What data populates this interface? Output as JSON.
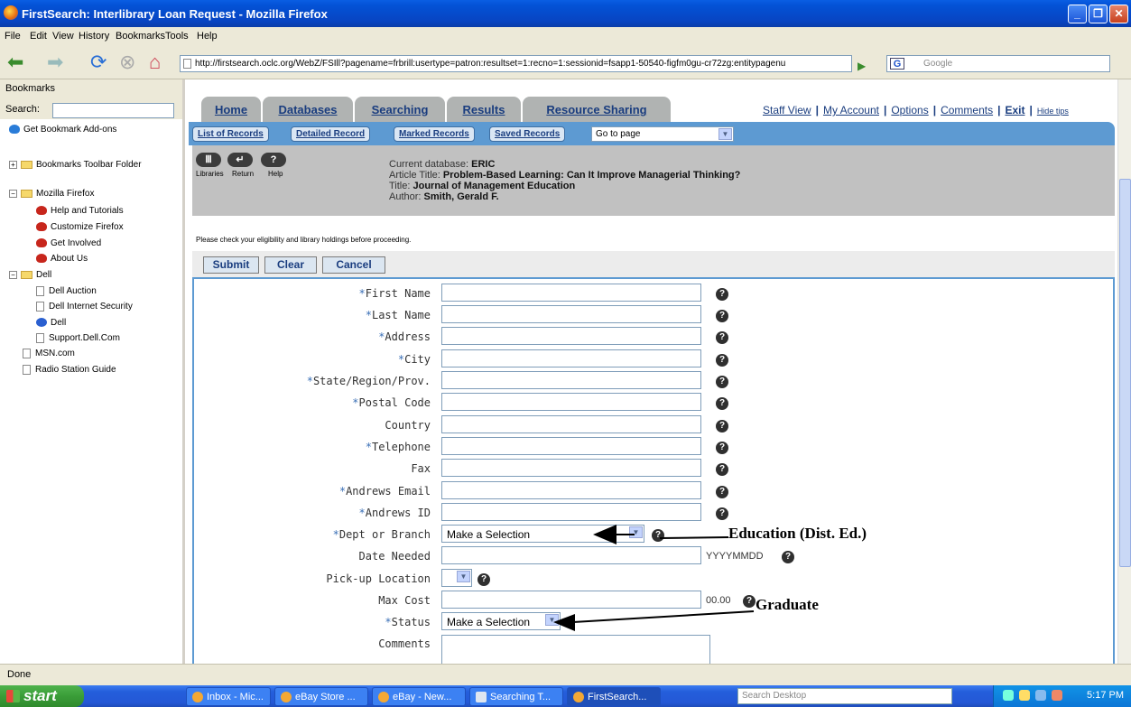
{
  "window": {
    "title": "FirstSearch: Interlibrary Loan Request - Mozilla Firefox"
  },
  "menu": [
    "File",
    "Edit",
    "View",
    "History",
    "Bookmarks",
    "Tools",
    "Help"
  ],
  "nav": {
    "url": "http://firstsearch.oclc.org/WebZ/FSIll?pagename=frbrill:usertype=patron:resultset=1:recno=1:sessionid=fsapp1-50540-figfm0gu-cr72zg:entitypagenu",
    "search_placeholder": "Google"
  },
  "sidebar": {
    "title": "Bookmarks",
    "search_label": "Search:",
    "items": [
      {
        "label": "Get Bookmark Add-ons"
      },
      {
        "label": "Bookmarks Toolbar Folder"
      },
      {
        "label": "Mozilla Firefox"
      },
      {
        "label": "Help and Tutorials"
      },
      {
        "label": "Customize Firefox"
      },
      {
        "label": "Get Involved"
      },
      {
        "label": "About Us"
      },
      {
        "label": "Dell"
      },
      {
        "label": "Dell Auction"
      },
      {
        "label": "Dell Internet Security"
      },
      {
        "label": "Dell"
      },
      {
        "label": "Support.Dell.Com"
      },
      {
        "label": "MSN.com"
      },
      {
        "label": "Radio Station Guide"
      }
    ]
  },
  "tabs": [
    "Home",
    "Databases",
    "Searching",
    "Results",
    "Resource Sharing"
  ],
  "toplinks": {
    "staff": "Staff View",
    "account": "My Account",
    "options": "Options",
    "comments": "Comments",
    "exit": "Exit",
    "hide": "Hide tips"
  },
  "subnav": {
    "items": [
      "List of Records",
      "Detailed Record",
      "Marked Records",
      "Saved Records"
    ],
    "goto": "Go to page"
  },
  "info": {
    "buttons": [
      "Libraries",
      "Return",
      "Help"
    ],
    "db_label": "Current database:",
    "db_value": "ERIC",
    "article_label": "Article Title:",
    "article_value": "Problem-Based Learning: Can It Improve Managerial Thinking?",
    "title_label": "Title:",
    "title_value": "Journal of Management Education",
    "author_label": "Author:",
    "author_value": "Smith, Gerald F."
  },
  "notice": "Please check your eligibility and library holdings before proceeding.",
  "actions": [
    "Submit",
    "Clear",
    "Cancel"
  ],
  "form": {
    "fields": [
      {
        "label": "First Name",
        "required": "*"
      },
      {
        "label": "Last Name",
        "required": "*"
      },
      {
        "label": "Address",
        "required": "*"
      },
      {
        "label": "City",
        "required": "*"
      },
      {
        "label": "State/Region/Prov.",
        "required": "*"
      },
      {
        "label": "Postal Code",
        "required": "*"
      },
      {
        "label": "Country",
        "required": ""
      },
      {
        "label": "Telephone",
        "required": "*"
      },
      {
        "label": "Fax",
        "required": ""
      },
      {
        "label": "Andrews Email",
        "required": "*"
      },
      {
        "label": "Andrews ID",
        "required": "*"
      }
    ],
    "dept_label": "Dept or Branch",
    "dept_value": "Make a Selection",
    "date_label": "Date Needed",
    "date_hint": "YYYYMMDD",
    "pickup_label": "Pick-up Location",
    "maxcost_label": "Max Cost",
    "maxcost_suffix": "00.00",
    "status_label": "Status",
    "status_value": "Make a Selection",
    "comments_label": "Comments",
    "req": "*"
  },
  "annotations": {
    "dept": "Education (Dist. Ed.)",
    "status": "Graduate"
  },
  "statusbar": "Done",
  "taskbar": {
    "start": "start",
    "buttons": [
      "Inbox - Mic...",
      "eBay Store ...",
      "eBay - New...",
      "Searching T...",
      "FirstSearch..."
    ],
    "desk_search": "Search Desktop",
    "clock": "5:17 PM"
  }
}
